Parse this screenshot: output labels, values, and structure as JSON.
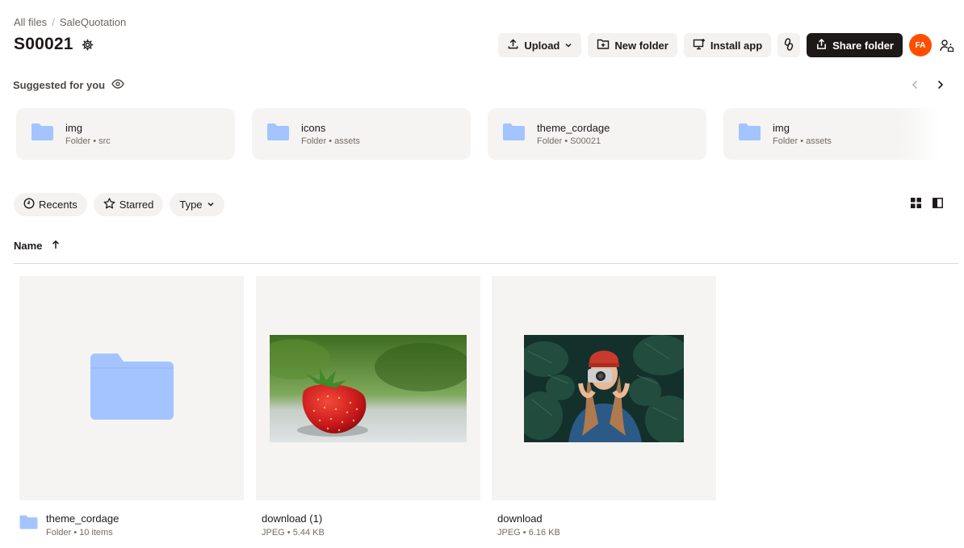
{
  "breadcrumb": {
    "root": "All files",
    "separator": "/",
    "current": "SaleQuotation"
  },
  "page": {
    "title": "S00021"
  },
  "toolbar": {
    "upload": "Upload",
    "new_folder": "New folder",
    "install_app": "Install app",
    "share_folder": "Share folder",
    "avatar_initials": "FA"
  },
  "suggested": {
    "heading": "Suggested for you",
    "items": [
      {
        "name": "img",
        "meta": "Folder • src"
      },
      {
        "name": "icons",
        "meta": "Folder • assets"
      },
      {
        "name": "theme_cordage",
        "meta": "Folder • S00021"
      },
      {
        "name": "img",
        "meta": "Folder • assets"
      }
    ]
  },
  "filters": {
    "recents": "Recents",
    "starred": "Starred",
    "type": "Type"
  },
  "list": {
    "name_header": "Name"
  },
  "files": [
    {
      "name": "theme_cordage",
      "meta": "Folder • 10 items",
      "kind": "folder"
    },
    {
      "name": "download (1)",
      "meta": "JPEG • 5.44 KB",
      "kind": "image-strawberry"
    },
    {
      "name": "download",
      "meta": "JPEG • 6.16 KB",
      "kind": "image-camera-girl"
    }
  ],
  "colors": {
    "folder": "#a3c4ff",
    "accent": "#ff4e00",
    "primary_button": "#1e1919"
  }
}
